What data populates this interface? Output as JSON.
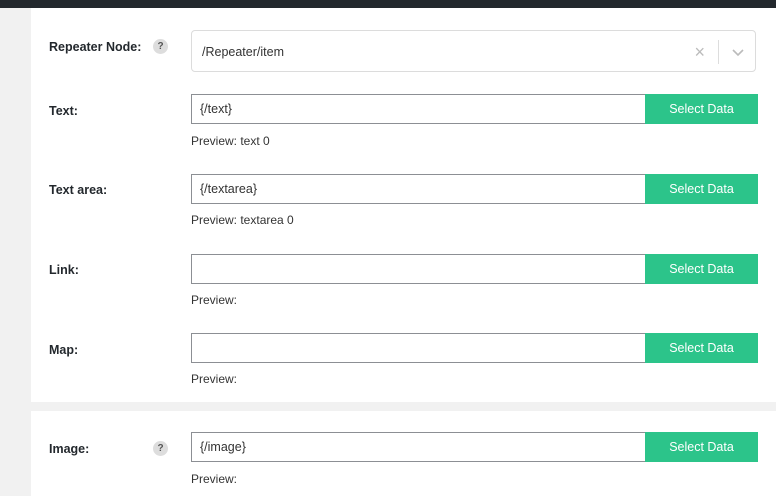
{
  "repeater": {
    "label": "Repeater Node:",
    "help": "?",
    "value": "/Repeater/item",
    "clear_glyph": "×"
  },
  "fields": [
    {
      "label": "Text:",
      "value": "{/text}",
      "button": "Select Data",
      "preview": "Preview: text 0"
    },
    {
      "label": "Text area:",
      "value": "{/textarea}",
      "button": "Select Data",
      "preview": "Preview: textarea 0"
    },
    {
      "label": "Link:",
      "value": "",
      "button": "Select Data",
      "preview": "Preview:"
    },
    {
      "label": "Map:",
      "value": "",
      "button": "Select Data",
      "preview": "Preview:"
    }
  ],
  "image": {
    "label": "Image:",
    "help": "?",
    "value": "{/image}",
    "button": "Select Data",
    "preview": "Preview:"
  },
  "colors": {
    "accent": "#2cc48a",
    "topbar": "#23282d",
    "background": "#f1f1f1"
  },
  "icons": [
    "help-icon",
    "clear-icon",
    "chevron-down-icon"
  ]
}
